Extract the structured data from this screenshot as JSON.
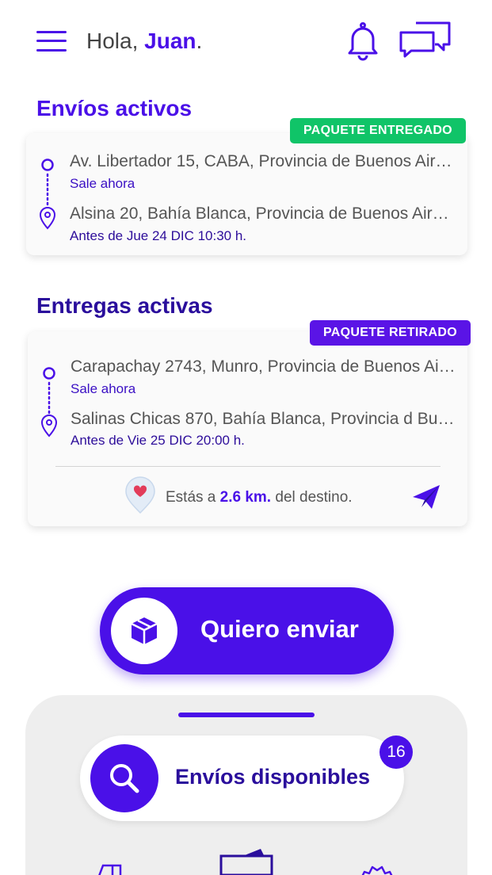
{
  "header": {
    "greeting_prefix": "Hola, ",
    "user_name": "Juan",
    "greeting_suffix": "."
  },
  "shipments": {
    "title": "Envíos activos",
    "card": {
      "status": "PAQUETE ENTREGADO",
      "status_color": "#10c468",
      "origin_address": "Av. Libertador 15, CABA, Provincia de Buenos Aires...",
      "origin_time": "Sale ahora",
      "destination_address": "Alsina 20, Bahía Blanca, Provincia de Buenos Aires...",
      "destination_time": "Antes de Jue 24 DIC 10:30 h."
    }
  },
  "deliveries": {
    "title": "Entregas activas",
    "card": {
      "status": "PAQUETE RETIRADO",
      "status_color": "#5a14e6",
      "origin_address": "Carapachay 2743, Munro, Provincia de Buenos Aires",
      "origin_time": "Sale ahora",
      "destination_address": "Salinas Chicas 870, Bahía Blanca, Provincia d Buen...",
      "destination_time": "Antes de Vie 25 DIC 20:00 h.",
      "distance_prefix": "Estás a ",
      "distance_value": "2.6 km.",
      "distance_suffix": " del destino."
    }
  },
  "cta": {
    "label": "Quiero enviar"
  },
  "bottom_sheet": {
    "available_label": "Envíos disponibles",
    "available_count": "16"
  },
  "colors": {
    "accent": "#4a10e8",
    "accent_dark": "#2a0e9c",
    "success": "#10c468"
  },
  "icons": [
    "menu-icon",
    "bell-icon",
    "chat-icon",
    "origin-circle-icon",
    "location-pin-icon",
    "heart-pin-icon",
    "send-icon",
    "box-icon",
    "search-icon",
    "truck-icon",
    "wallet-icon",
    "gear-icon"
  ]
}
